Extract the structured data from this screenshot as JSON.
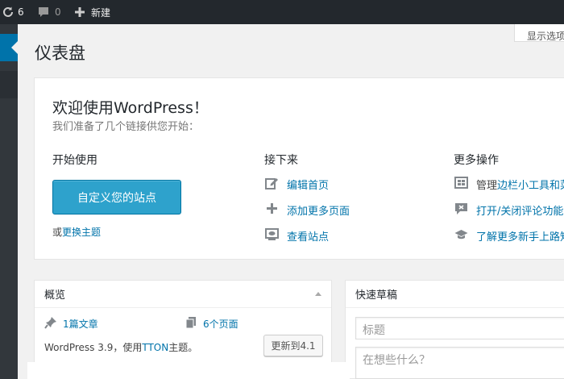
{
  "adminbar": {
    "updates_count": "6",
    "comments_count": "0",
    "new_label": "新建"
  },
  "screen_options": {
    "label": "显示选项"
  },
  "page": {
    "title": "仪表盘"
  },
  "welcome": {
    "title": "欢迎使用WordPress！",
    "subtitle": "我们准备了几个链接供您开始：",
    "col1": {
      "heading": "开始使用",
      "button": "自定义您的站点",
      "or_text": "或",
      "change_theme": "更换主题"
    },
    "col2": {
      "heading": "接下来",
      "actions": [
        {
          "label": "编辑首页",
          "icon": "edit-icon"
        },
        {
          "label": "添加更多页面",
          "icon": "plus-icon"
        },
        {
          "label": "查看站点",
          "icon": "view-icon"
        }
      ]
    },
    "col3": {
      "heading": "更多操作",
      "manage_prefix": "管理",
      "manage_links": "边栏小工具和菜",
      "comments_link": "打开/关闭评论功能",
      "learn_link": "了解更多新手上路知"
    }
  },
  "overview": {
    "title": "概览",
    "posts": "1篇文章",
    "pages": "6个页面",
    "version_prefix": "WordPress 3.9，使用",
    "theme_name": "TTON",
    "version_suffix": "主题。",
    "update_button": "更新到4.1"
  },
  "quick_draft": {
    "title": "快速草稿",
    "title_placeholder": "标题",
    "content_placeholder": "在想些什么？"
  },
  "colors": {
    "adminbar_bg": "#23282d",
    "menu_bg": "#32373c",
    "accent": "#0073aa",
    "button_primary": "#2ea2cc"
  }
}
